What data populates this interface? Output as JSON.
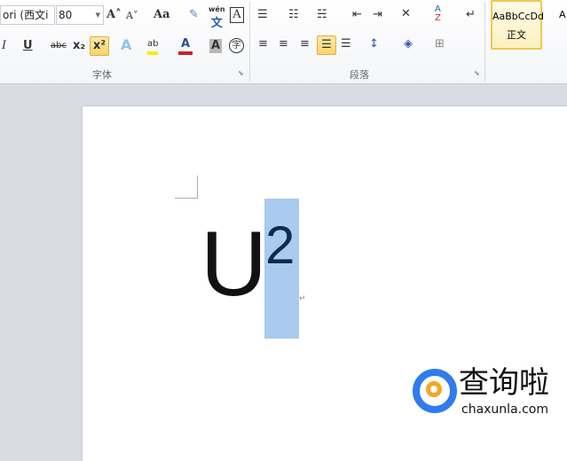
{
  "font_group": {
    "font_name": "ori (西文i",
    "font_size": "80",
    "label": "字体",
    "icons": [
      "grow-font-icon",
      "shrink-font-icon",
      "change-case-icon",
      "clear-formatting-icon",
      "phonetic-guide-icon",
      "character-border-icon",
      "italic-icon",
      "underline-icon",
      "strikethrough-icon",
      "subscript-icon",
      "superscript-icon",
      "text-effects-icon",
      "highlight-icon",
      "font-color-icon",
      "character-shading-icon",
      "enclose-characters-icon"
    ],
    "glyphs": {
      "grow": "A˄",
      "shrink": "A˅",
      "case": "Aa",
      "phonetic": "wén",
      "phonetic_char": "文",
      "border": "A",
      "italic": "I",
      "underline": "U",
      "strike": "abc",
      "sub": "x₂",
      "sup": "x²",
      "effects": "A",
      "highlight": "ab",
      "color": "A",
      "shade": "A",
      "enclose": "字"
    }
  },
  "paragraph_group": {
    "label": "段落"
  },
  "styles_group": {
    "preview": "AaBbCcDd",
    "name": "正文",
    "next_preview": "A"
  },
  "document": {
    "base_text": "U",
    "superscript_text": "2",
    "paragraph_mark": "↵"
  },
  "watermark": {
    "name": "查询啦",
    "url": "chaxunla.com"
  },
  "colors": {
    "highlight": "#f5f000",
    "font_color": "#d02020",
    "selection": "#a9cbef",
    "active": "#f8d46a"
  }
}
